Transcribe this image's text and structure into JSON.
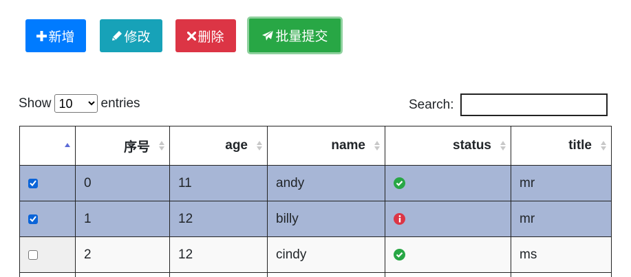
{
  "toolbar": {
    "add_label": "新增",
    "edit_label": "修改",
    "delete_label": "删除",
    "batch_submit_label": "批量提交"
  },
  "length_control": {
    "prefix": "Show",
    "selected": "10",
    "suffix": "entries"
  },
  "search": {
    "label": "Search:",
    "value": ""
  },
  "table": {
    "columns": [
      "",
      "序号",
      "age",
      "name",
      "status",
      "title"
    ],
    "rows": [
      {
        "checked": true,
        "index": "0",
        "age": "11",
        "name": "andy",
        "status": "ok",
        "title": "mr"
      },
      {
        "checked": true,
        "index": "1",
        "age": "12",
        "name": "billy",
        "status": "info",
        "title": "mr"
      },
      {
        "checked": false,
        "index": "2",
        "age": "12",
        "name": "cindy",
        "status": "ok",
        "title": "ms"
      }
    ]
  },
  "colors": {
    "add": "#007bff",
    "edit": "#17a2b8",
    "delete": "#dc3545",
    "submit": "#28a745",
    "selected_row": "#a7b6d6",
    "status_ok": "#28a745",
    "status_info": "#dc3545"
  },
  "icons": {
    "add": "plus-icon",
    "edit": "pencil-icon",
    "delete": "times-icon",
    "submit": "paper-plane-icon",
    "status_ok": "check-circle-icon",
    "status_info": "info-circle-icon"
  }
}
